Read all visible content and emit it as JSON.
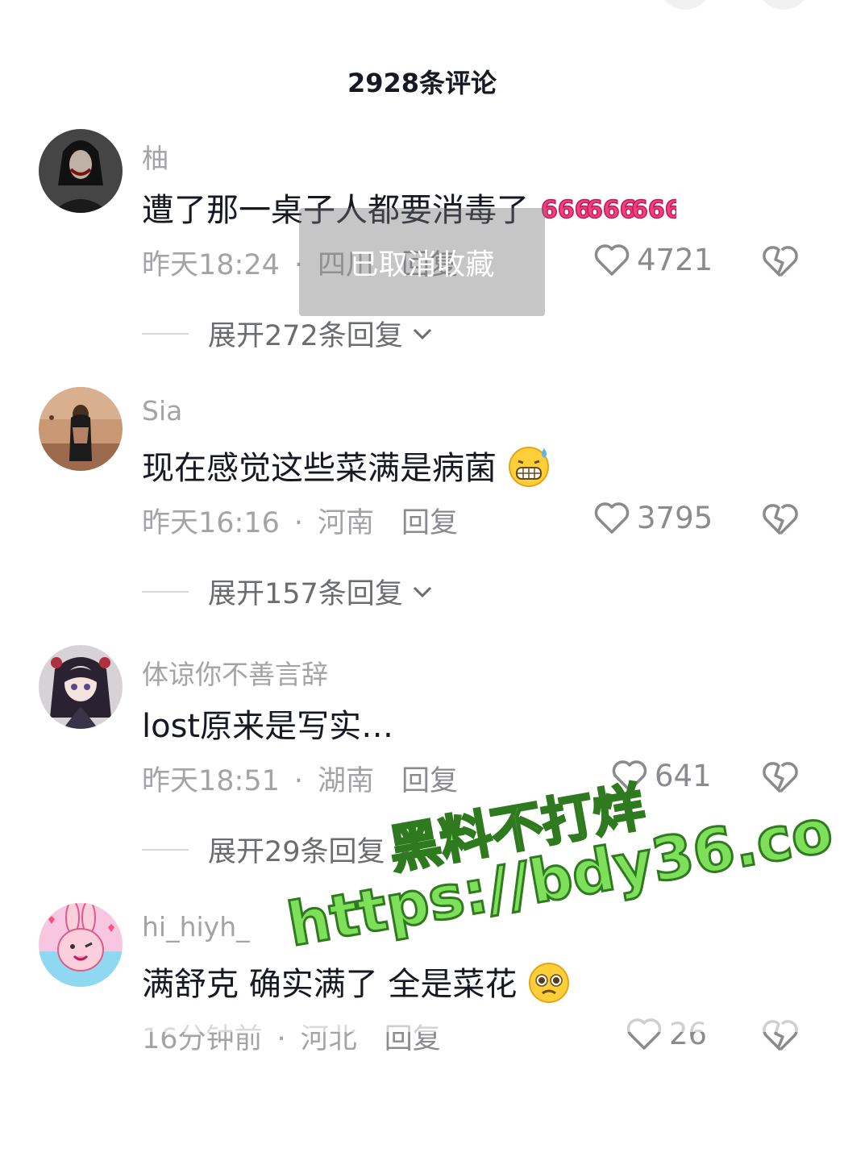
{
  "header": {
    "title": "2928条评论"
  },
  "toast": {
    "text": "已取消收藏"
  },
  "comments": [
    {
      "username": "柚",
      "text": "遭了那一桌子人都要消毒了",
      "emoji": "666-emoji",
      "time": "昨天18:24",
      "location": "四川",
      "reply_label": "回复",
      "likes": "4721",
      "expand_label": "展开272条回复"
    },
    {
      "username": "Sia",
      "text": "现在感觉这些菜满是病菌",
      "emoji": "grimace-sweat-emoji",
      "time": "昨天16:16",
      "location": "河南",
      "reply_label": "回复",
      "likes": "3795",
      "expand_label": "展开157条回复"
    },
    {
      "username": "体谅你不善言辞",
      "text": "lost原来是写实…",
      "emoji": "",
      "time": "昨天18:51",
      "location": "湖南",
      "reply_label": "回复",
      "likes": "641",
      "expand_label": "展开29条回复"
    },
    {
      "username": "hi_hiyh_",
      "text": "满舒克 确实满了 全是菜花",
      "emoji": "pleading-emoji",
      "time": "16分钟前",
      "location": "河北",
      "reply_label": "回复",
      "likes": "26",
      "expand_label": ""
    }
  ],
  "watermark": {
    "line1": "黑料不打烊",
    "line2": "https://bdy36.co"
  },
  "colors": {
    "text": "#161823",
    "meta": "#a3a3a8",
    "watermark_fill": "#7ee05a",
    "watermark_stroke": "#2f7a1e"
  }
}
